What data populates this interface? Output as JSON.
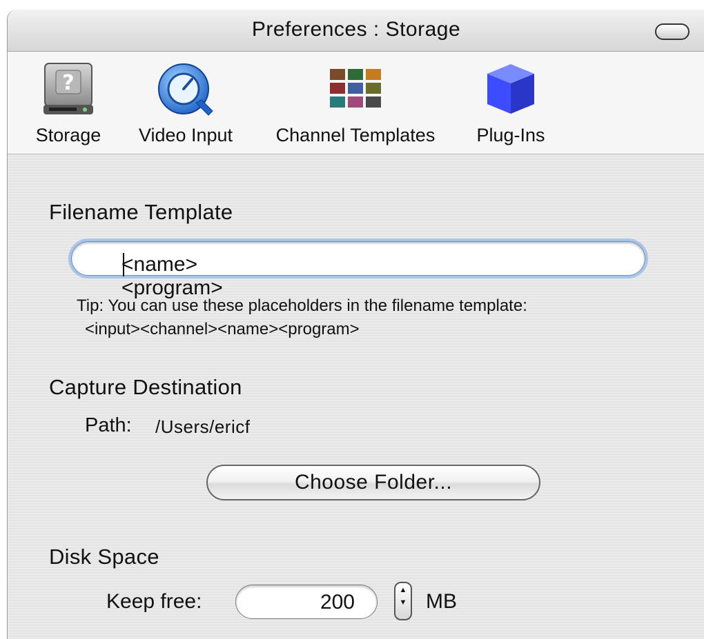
{
  "window": {
    "title": "Preferences : Storage"
  },
  "toolbar": {
    "items": [
      {
        "label": "Storage",
        "icon": "hard-drive-icon"
      },
      {
        "label": "Video Input",
        "icon": "quicktime-icon"
      },
      {
        "label": "Channel Templates",
        "icon": "channel-grid-icon"
      },
      {
        "label": "Plug-Ins",
        "icon": "blue-cube-icon"
      }
    ]
  },
  "filename": {
    "heading": "Filename Template",
    "value": "<name><program>",
    "tip_line1": "Tip: You can use these placeholders in the filename template:",
    "tip_line2": "<input><channel><name><program>"
  },
  "capture": {
    "heading": "Capture Destination",
    "path_label": "Path:",
    "path_value": "/Users/ericf",
    "choose_button": "Choose Folder..."
  },
  "disk": {
    "heading": "Disk Space",
    "keep_free_label": "Keep free:",
    "keep_free_value": "200",
    "unit": "MB"
  },
  "colors": {
    "focus_ring": "#a9c6ea",
    "cube_blue": "#3b4dff"
  }
}
